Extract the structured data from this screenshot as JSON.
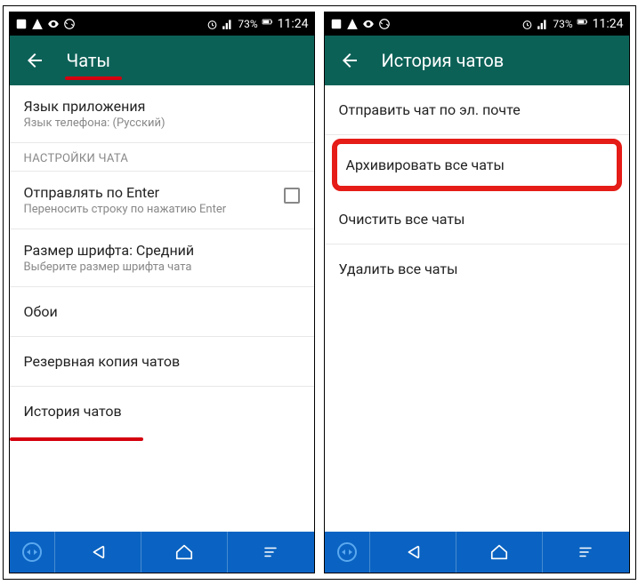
{
  "status": {
    "battery": "73%",
    "time": "11:24"
  },
  "left": {
    "title": "Чаты",
    "lang_item": {
      "primary": "Язык приложения",
      "secondary": "Язык телефона: (Русский)"
    },
    "section_chat_settings": "НАСТРОЙКИ ЧАТА",
    "enter_item": {
      "primary": "Отправлять по Enter",
      "secondary": "Переносить строку по нажатию Enter"
    },
    "font_item": {
      "primary": "Размер шрифта: Средний",
      "secondary": "Выберите размер шрифта чата"
    },
    "wallpaper": "Обои",
    "backup": "Резервная копия чатов",
    "history": "История чатов"
  },
  "right": {
    "title": "История чатов",
    "email": "Отправить чат по эл. почте",
    "archive": "Архивировать все чаты",
    "clear": "Очистить все чаты",
    "delete": "Удалить все чаты"
  }
}
